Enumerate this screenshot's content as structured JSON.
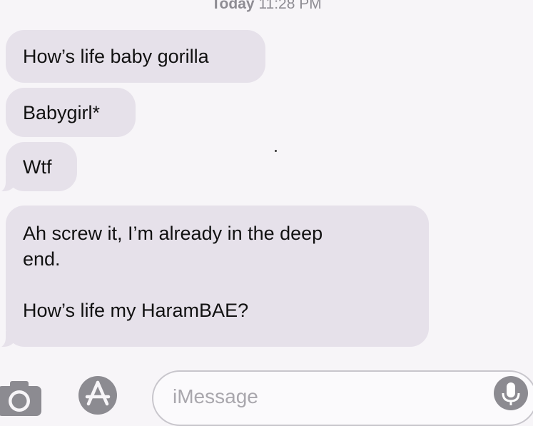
{
  "header": {
    "day": "Today",
    "time": "11:28 PM"
  },
  "messages": [
    {
      "lines": [
        "How’s life baby gorilla"
      ]
    },
    {
      "lines": [
        "Babygirl*"
      ]
    },
    {
      "lines": [
        "Wtf"
      ]
    },
    {
      "lines": [
        "Ah screw it, I’m already in the deep",
        "end.",
        "",
        "How’s life my HaramBAE?"
      ]
    }
  ],
  "compose": {
    "placeholder": "iMessage"
  },
  "icons": {
    "camera": "camera-icon",
    "apps": "app-store-icon",
    "mic": "microphone-icon"
  }
}
